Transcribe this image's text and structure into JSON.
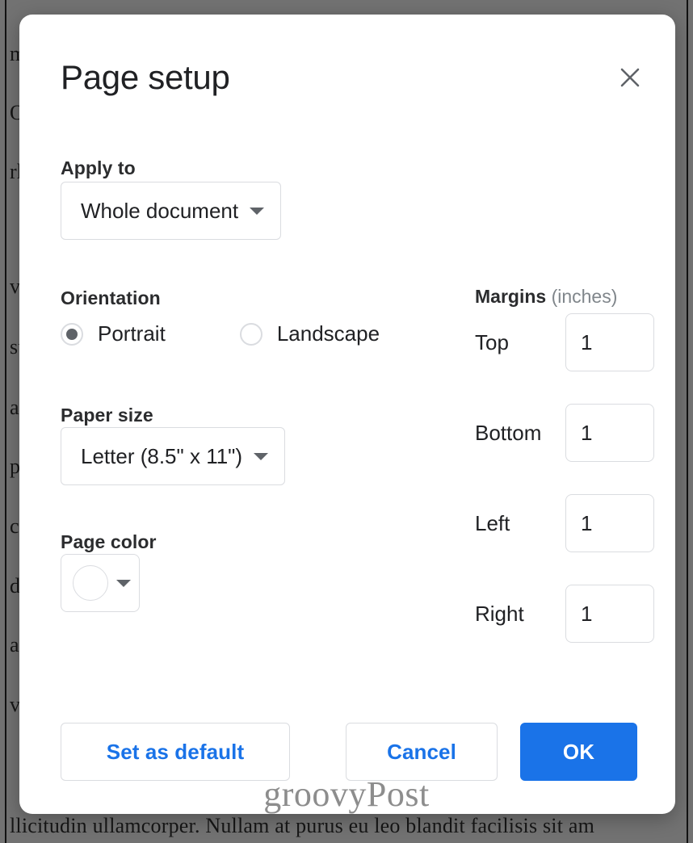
{
  "dialog": {
    "title": "Page setup",
    "close_icon": "close-icon",
    "apply_to": {
      "label": "Apply to",
      "value": "Whole document",
      "caret_icon": "chevron-down-icon"
    },
    "orientation": {
      "label": "Orientation",
      "options": [
        {
          "label": "Portrait",
          "selected": true
        },
        {
          "label": "Landscape",
          "selected": false
        }
      ]
    },
    "paper_size": {
      "label": "Paper size",
      "value": "Letter (8.5\" x 11\")",
      "caret_icon": "chevron-down-icon"
    },
    "page_color": {
      "label": "Page color",
      "swatch_color": "#ffffff",
      "caret_icon": "chevron-down-icon"
    },
    "margins": {
      "heading_bold": "Margins",
      "heading_unit": " (inches)",
      "fields": [
        {
          "label": "Top",
          "value": "1"
        },
        {
          "label": "Bottom",
          "value": "1"
        },
        {
          "label": "Left",
          "value": "1"
        },
        {
          "label": "Right",
          "value": "1"
        }
      ]
    },
    "footer": {
      "set_as_default": "Set as default",
      "cancel": "Cancel",
      "ok": "OK"
    }
  },
  "watermark": {
    "text": "groovyPost"
  },
  "background_document": {
    "lines": [
      "mauris of",
      "ODIO NO",
      "rhoncus nu",
      "vestibulum ve",
      "suspendisse ale",
      "at dignissim p",
      "pellentesque hi",
      "consequat an",
      "dignissim aug",
      "ante ipsum do.",
      "vulputate nc",
      "llicitudin ullamcorper. Nullam at purus eu leo blandit facilisis sit am"
    ]
  },
  "colors": {
    "accent": "#1a73e8",
    "text_primary": "#202124",
    "text_secondary": "#80868b",
    "border": "#dadce0",
    "scrim": "#141414"
  }
}
